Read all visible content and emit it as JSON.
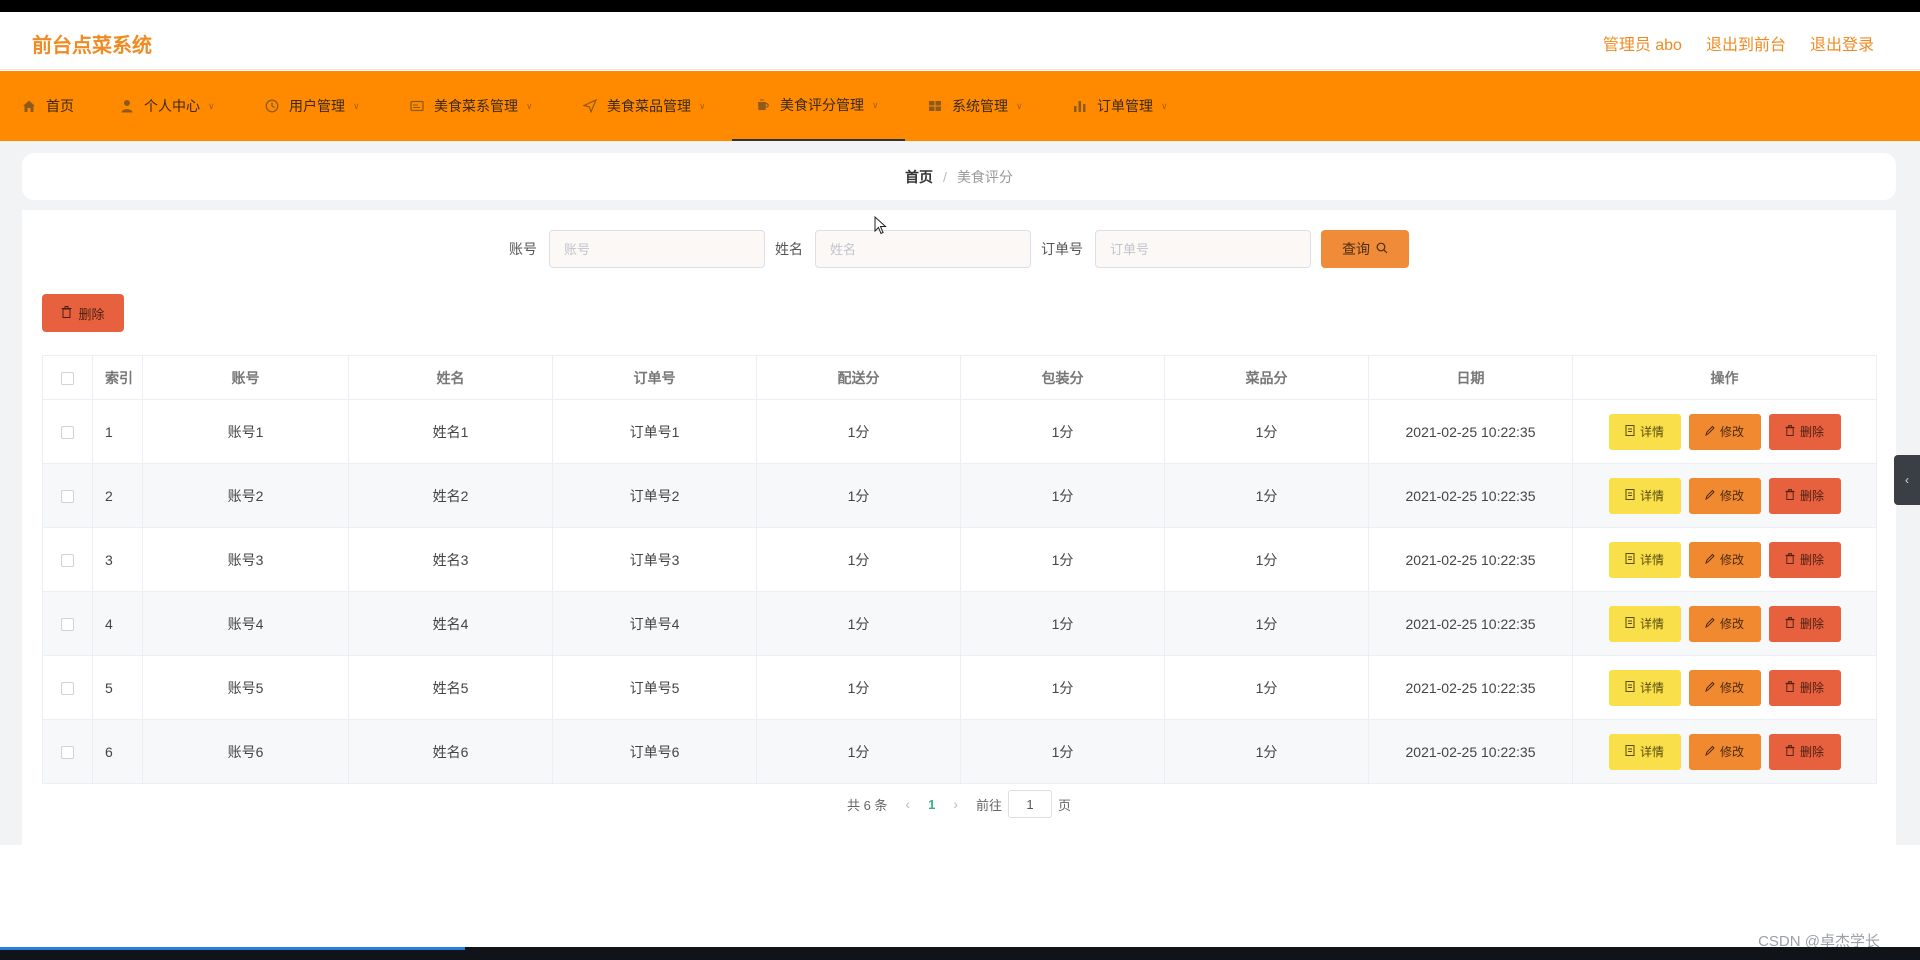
{
  "app": {
    "title": "前台点菜系统"
  },
  "header": {
    "links": [
      "管理员 abo",
      "退出到前台",
      "退出登录"
    ]
  },
  "nav": {
    "items": [
      {
        "label": "首页",
        "icon": "home-icon",
        "has_caret": false
      },
      {
        "label": "个人中心",
        "icon": "user-icon",
        "has_caret": true
      },
      {
        "label": "用户管理",
        "icon": "clock-icon",
        "has_caret": true
      },
      {
        "label": "美食菜系管理",
        "icon": "card-icon",
        "has_caret": true
      },
      {
        "label": "美食菜品管理",
        "icon": "send-icon",
        "has_caret": true
      },
      {
        "label": "美食评分管理",
        "icon": "cup-icon",
        "has_caret": true,
        "active": true
      },
      {
        "label": "系统管理",
        "icon": "grid-icon",
        "has_caret": true
      },
      {
        "label": "订单管理",
        "icon": "chart-icon",
        "has_caret": true
      }
    ]
  },
  "breadcrumb": {
    "home": "首页",
    "separator": "/",
    "current": "美食评分"
  },
  "search": {
    "fields": [
      {
        "label": "账号",
        "placeholder": "账号",
        "value": ""
      },
      {
        "label": "姓名",
        "placeholder": "姓名",
        "value": ""
      },
      {
        "label": "订单号",
        "placeholder": "订单号",
        "value": ""
      }
    ],
    "button_label": "查询"
  },
  "toolbar": {
    "delete_label": "删除"
  },
  "table": {
    "columns": [
      "索引",
      "账号",
      "姓名",
      "订单号",
      "配送分",
      "包装分",
      "菜品分",
      "日期",
      "操作"
    ],
    "rows": [
      {
        "index": "1",
        "account": "账号1",
        "name": "姓名1",
        "order": "订单号1",
        "delivery": "1分",
        "packaging": "1分",
        "dish": "1分",
        "date": "2021-02-25 10:22:35"
      },
      {
        "index": "2",
        "account": "账号2",
        "name": "姓名2",
        "order": "订单号2",
        "delivery": "1分",
        "packaging": "1分",
        "dish": "1分",
        "date": "2021-02-25 10:22:35"
      },
      {
        "index": "3",
        "account": "账号3",
        "name": "姓名3",
        "order": "订单号3",
        "delivery": "1分",
        "packaging": "1分",
        "dish": "1分",
        "date": "2021-02-25 10:22:35"
      },
      {
        "index": "4",
        "account": "账号4",
        "name": "姓名4",
        "order": "订单号4",
        "delivery": "1分",
        "packaging": "1分",
        "dish": "1分",
        "date": "2021-02-25 10:22:35"
      },
      {
        "index": "5",
        "account": "账号5",
        "name": "姓名5",
        "order": "订单号5",
        "delivery": "1分",
        "packaging": "1分",
        "dish": "1分",
        "date": "2021-02-25 10:22:35"
      },
      {
        "index": "6",
        "account": "账号6",
        "name": "姓名6",
        "order": "订单号6",
        "delivery": "1分",
        "packaging": "1分",
        "dish": "1分",
        "date": "2021-02-25 10:22:35"
      }
    ],
    "row_actions": {
      "detail": "详情",
      "edit": "修改",
      "delete": "删除"
    }
  },
  "pagination": {
    "total": "共 6 条",
    "current_page": "1",
    "goto_label": "前往",
    "goto_value": "1",
    "page_unit": "页"
  },
  "watermark": "CSDN @卓杰学长",
  "colors": {
    "accent": "#ff8a00",
    "brand_text": "#f08b23",
    "detail": "#f9e04a",
    "edit": "#f0892f",
    "delete": "#e8613f",
    "page_active": "#3ab089"
  }
}
